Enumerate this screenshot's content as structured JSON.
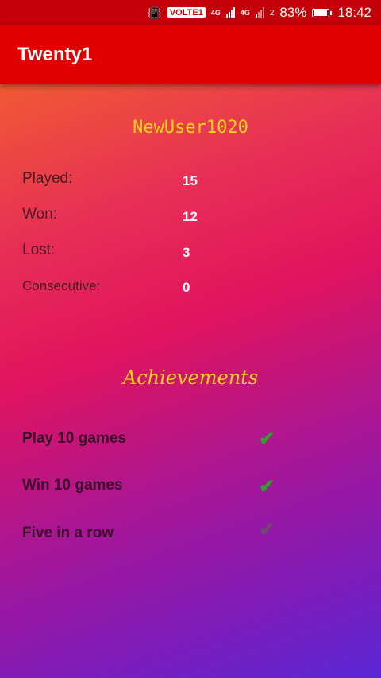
{
  "status_bar": {
    "volte": "VOLTE",
    "volte_sim": "1",
    "network_1": "4G",
    "network_2": "4G",
    "sim_2": "2",
    "battery_percent": "83%",
    "battery_level": 0.83,
    "time": "18:42"
  },
  "app_bar": {
    "title": "Twenty1"
  },
  "profile": {
    "username": "NewUser1020",
    "stats": [
      {
        "label": "Played:",
        "value": "15"
      },
      {
        "label": "Won:",
        "value": "12"
      },
      {
        "label": "Lost:",
        "value": "3"
      },
      {
        "label": "Consecutive:",
        "value": "0"
      }
    ]
  },
  "achievements": {
    "title": "Achievements",
    "items": [
      {
        "label": "Play 10 games",
        "completed": true,
        "check_icon": "checkmark-icon",
        "check_color": "#2fa02c"
      },
      {
        "label": "Win 10 games",
        "completed": true,
        "check_icon": "checkmark-icon",
        "check_color": "#2fa02c"
      },
      {
        "label": "Five in a row",
        "completed": false,
        "check_icon": "checkmark-icon",
        "check_color": "#6e4a6a"
      }
    ]
  },
  "colors": {
    "status_bar": "#c30008",
    "app_bar": "#e00000",
    "username": "#f7d21b",
    "achievement_title": "#f7d21b",
    "stat_value": "#ffffff"
  }
}
